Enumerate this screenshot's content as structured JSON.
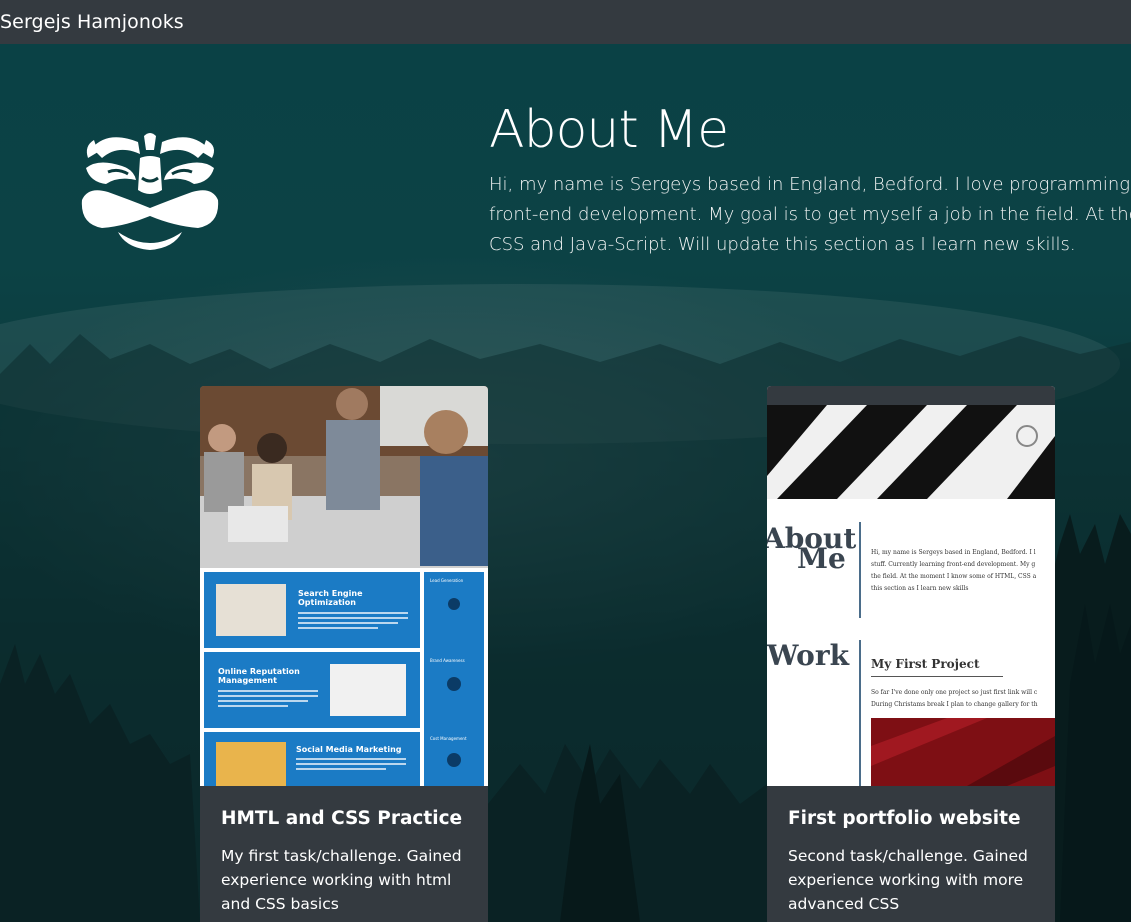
{
  "navbar": {
    "brand": "Sergejs Hamjonoks"
  },
  "about": {
    "title": "About Me",
    "lines": [
      "Hi, my name is Sergeys based in England, Bedford. I love programming and t",
      "front-end development. My goal is to get myself a job in the field. At the mor",
      "CSS and Java-Script. Will update this section as I learn new skills."
    ]
  },
  "logo": {
    "icon": "mask-icon"
  },
  "cards": [
    {
      "title": "HMTL and CSS Practice",
      "text": "My first task/challenge. Gained experience working with html and CSS basics",
      "thumb": {
        "panels": [
          {
            "title_line1": "Search Engine",
            "title_line2": "Optimization"
          },
          {
            "title_line1": "Online Reputation",
            "title_line2": "Management"
          },
          {
            "title_line1": "Social Media Marketing",
            "title_line2": ""
          }
        ],
        "side_labels": [
          "Lead Generation",
          "Brand Awareness",
          "Cost Management"
        ]
      }
    },
    {
      "title": "First portfolio website",
      "text": "Second task/challenge. Gained experience working with more advanced CSS",
      "thumb": {
        "heading1_line1": "About",
        "heading1_line2": "Me",
        "heading2": "Work",
        "about_lines": [
          "Hi, my name is Sergeys based in England, Bedford. I l",
          "stuff. Currently learning front-end development. My g",
          "the field. At the moment I know some of HTML, CSS a",
          "this section as I learn new skills"
        ],
        "project_title": "My First Project",
        "project_lines": [
          "So far I've done only one project so just first link will c",
          "During Christams break I plan to change gallery for th"
        ]
      }
    }
  ]
}
